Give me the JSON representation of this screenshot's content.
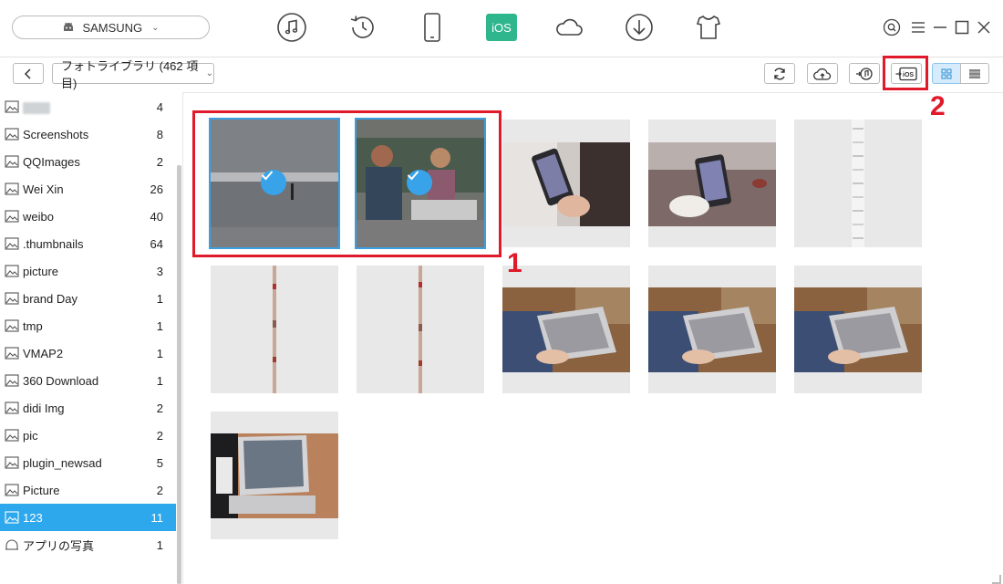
{
  "device": {
    "name": "SAMSUNG"
  },
  "nav": {
    "items": [
      {
        "name": "music-icon"
      },
      {
        "name": "history-icon"
      },
      {
        "name": "phone-icon"
      },
      {
        "name": "ios-icon",
        "label": "iOS",
        "active": true
      },
      {
        "name": "cloud-icon"
      },
      {
        "name": "download-icon"
      },
      {
        "name": "tshirt-icon"
      }
    ]
  },
  "toolbar": {
    "library_label": "フォトライブラリ (462 項目)"
  },
  "sidebar": {
    "items": [
      {
        "label": "",
        "count": "4",
        "blurred": true
      },
      {
        "label": "Screenshots",
        "count": "8"
      },
      {
        "label": "QQImages",
        "count": "2"
      },
      {
        "label": "Wei Xin",
        "count": "26"
      },
      {
        "label": "weibo",
        "count": "40"
      },
      {
        "label": ".thumbnails",
        "count": "64"
      },
      {
        "label": "picture",
        "count": "3"
      },
      {
        "label": "brand  Day",
        "count": "1"
      },
      {
        "label": "tmp",
        "count": "1"
      },
      {
        "label": "VMAP2",
        "count": "1"
      },
      {
        "label": "360  Download",
        "count": "1"
      },
      {
        "label": "didi  Img",
        "count": "2"
      },
      {
        "label": "pic",
        "count": "2"
      },
      {
        "label": "plugin_newsad",
        "count": "5"
      },
      {
        "label": "Picture",
        "count": "2"
      },
      {
        "label": "123",
        "count": "11",
        "selected": true
      },
      {
        "label": "アプリの写真",
        "count": "1",
        "app": true
      }
    ]
  },
  "annotations": {
    "one": "1",
    "two": "2"
  },
  "colors": {
    "accent": "#2da8ec",
    "ios_green": "#2fb68d",
    "highlight_red": "#e0192b"
  }
}
